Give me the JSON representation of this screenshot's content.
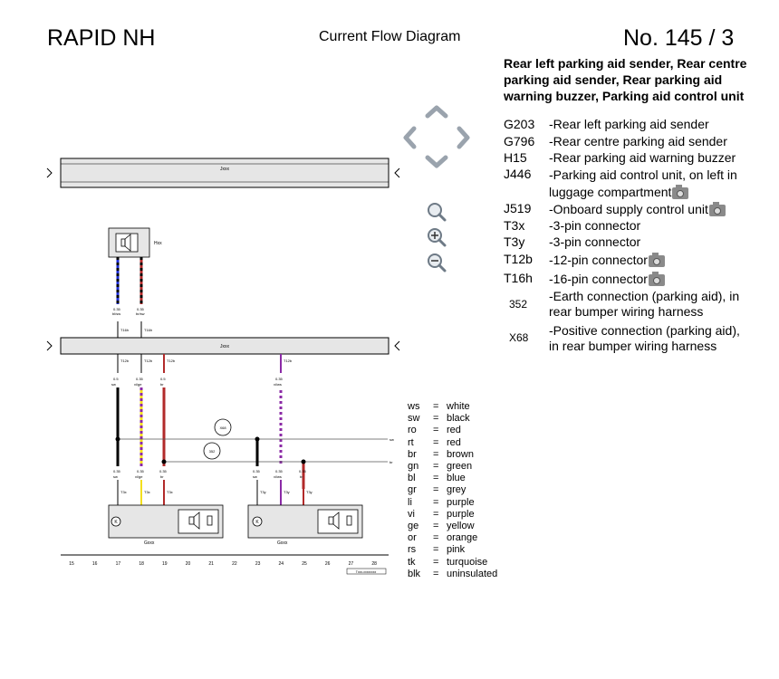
{
  "header": {
    "model": "RAPID NH",
    "subtitle": "Current Flow Diagram",
    "page_number": "No.  145 / 3"
  },
  "legend": {
    "title": "Rear left parking aid sender, Rear centre parking aid sender, Rear parking aid warning buzzer, Parking aid control unit",
    "items": [
      {
        "code": "G203",
        "desc": "-Rear left parking aid sender"
      },
      {
        "code": "G796",
        "desc": "-Rear centre parking aid sender"
      },
      {
        "code": "H15",
        "desc": "-Rear parking aid warning buzzer"
      },
      {
        "code": "J446",
        "desc": "-Parking aid control unit, on left in luggage compartment"
      },
      {
        "code": "J519",
        "desc": "-Onboard supply control unit"
      },
      {
        "code": "T3x",
        "desc": "-3-pin connector"
      },
      {
        "code": "T3y",
        "desc": "-3-pin connector"
      },
      {
        "code": "T12b",
        "desc": "-12-pin connector"
      },
      {
        "code": "T16h",
        "desc": "-16-pin connector"
      },
      {
        "code": "352",
        "desc": "-Earth connection (parking aid), in rear bumper wiring harness"
      },
      {
        "code": "X68",
        "desc": "-Positive connection (parking aid), in rear bumper wiring harness"
      }
    ]
  },
  "color_codes": [
    {
      "abbr": "ws",
      "name": "white"
    },
    {
      "abbr": "sw",
      "name": "black"
    },
    {
      "abbr": "ro",
      "name": "red"
    },
    {
      "abbr": "rt",
      "name": "red"
    },
    {
      "abbr": "br",
      "name": "brown"
    },
    {
      "abbr": "gn",
      "name": "green"
    },
    {
      "abbr": "bl",
      "name": "blue"
    },
    {
      "abbr": "gr",
      "name": "grey"
    },
    {
      "abbr": "li",
      "name": "purple"
    },
    {
      "abbr": "vi",
      "name": "purple"
    },
    {
      "abbr": "ge",
      "name": "yellow"
    },
    {
      "abbr": "or",
      "name": "orange"
    },
    {
      "abbr": "rs",
      "name": "pink"
    },
    {
      "abbr": "tk",
      "name": "turquoise"
    },
    {
      "abbr": "blk",
      "name": "uninsulated"
    }
  ],
  "diagram": {
    "bus_top_label": "Jxxx",
    "bus_mid_label": "Jxxx",
    "buzzer_label": "Hxx",
    "sensor_left_label": "Gxxx",
    "sensor_right_label": "Gxxx",
    "node_x68": "X68",
    "node_352": "352",
    "column_numbers": [
      "15",
      "16",
      "17",
      "18",
      "19",
      "20",
      "21",
      "22",
      "23",
      "24",
      "25",
      "26",
      "27",
      "28"
    ],
    "footer_code": "Txxx-xxxxxxxx"
  },
  "colors": {
    "blue": "#1f2fd6",
    "black": "#000000",
    "red": "#b22a2a",
    "yellow": "#f3df1e",
    "purple": "#8b2aa6",
    "bus_fill": "#e6e6e6",
    "nav_grey": "#9aa3ad"
  },
  "icons": [
    "chevron-up-icon",
    "chevron-down-icon",
    "chevron-left-icon",
    "chevron-right-icon",
    "zoom-fit-icon",
    "zoom-in-icon",
    "zoom-out-icon",
    "camera-icon"
  ]
}
